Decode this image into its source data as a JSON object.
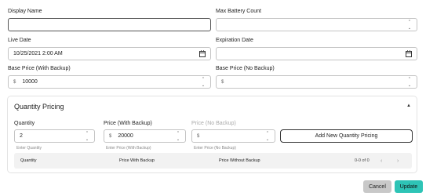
{
  "form": {
    "display_name": {
      "label": "Display Name",
      "value": ""
    },
    "max_battery_count": {
      "label": "Max Battery Count",
      "value": ""
    },
    "live_date": {
      "label": "Live Date",
      "value": "10/25/2021 2:00 AM"
    },
    "expiration_date": {
      "label": "Expiration Date",
      "value": ""
    },
    "base_price_backup": {
      "label": "Base Price (With Backup)",
      "prefix": "$",
      "value": "10000"
    },
    "base_price_no_backup": {
      "label": "Base Price (No Backup)",
      "prefix": "$",
      "value": ""
    }
  },
  "quantity_pricing": {
    "title": "Quantity Pricing",
    "quantity": {
      "label": "Quantity",
      "value": "2",
      "help": "Enter Quantity"
    },
    "price_with_backup": {
      "label": "Price (With Backup)",
      "prefix": "$",
      "value": "20000",
      "help": "Enter Price (With Backup)"
    },
    "price_no_backup": {
      "label": "Price (No Backup)",
      "prefix": "$",
      "value": "",
      "help": "Enter Price (No Backup)"
    },
    "add_button": "Add New Quantity Pricing",
    "table": {
      "columns": [
        "Quantity",
        "Price With Backup",
        "Price Without Backup"
      ],
      "pagination": "0-0 of 0"
    }
  },
  "actions": {
    "cancel": "Cancel",
    "update": "Update"
  },
  "colors": {
    "accent": "#2ec4b6",
    "cancel_bg": "#c8c8c8"
  }
}
